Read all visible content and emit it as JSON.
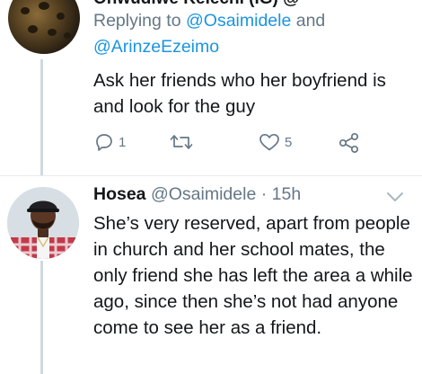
{
  "tweet1": {
    "header_cut": "Onwudiwe Kelechi (IG) @",
    "reply_prefix": "Replying to ",
    "mention1": "@Osaimidele",
    "reply_and": " and",
    "mention2": "@ArinzeEzeimo",
    "text": "Ask her friends who her boyfriend is and look for the guy",
    "reply_count": "1",
    "retweet_count": "",
    "like_count": "5"
  },
  "tweet2": {
    "name": "Hosea",
    "handle": "@Osaimidele",
    "separator": " · ",
    "time": "15h",
    "text": "She’s very reserved, apart from people in church and her school mates, the only friend she has left the area a while ago, since then she’s not had anyone come to see her as a friend."
  },
  "icons": {
    "reply": "reply-icon",
    "retweet": "retweet-icon",
    "like": "heart-icon",
    "share": "share-icon",
    "caret": "chevron-down-icon"
  },
  "colors": {
    "text": "#14171a",
    "secondary": "#657786",
    "link": "#1b95e0",
    "thread_line": "#cfd9de"
  }
}
